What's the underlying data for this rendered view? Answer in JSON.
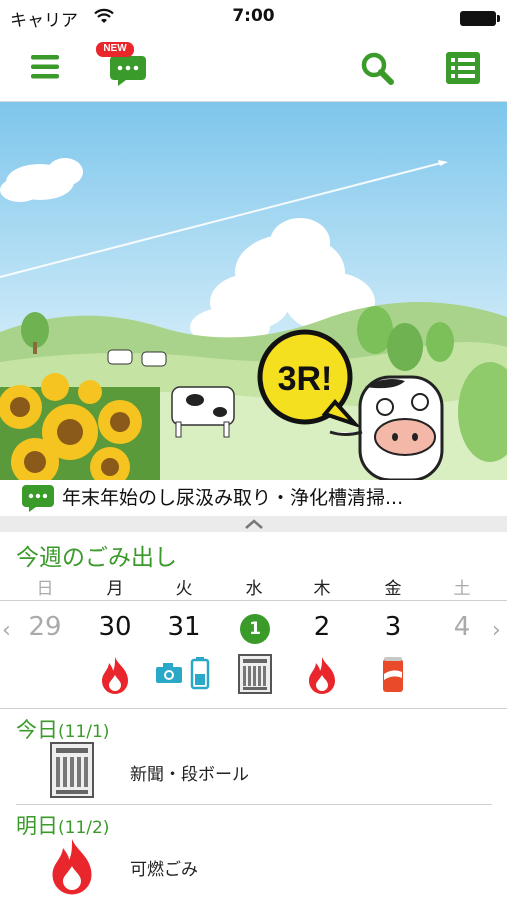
{
  "status_bar": {
    "carrier": "キャリア",
    "time": "7:00"
  },
  "toolbar": {
    "new_badge": "NEW"
  },
  "banner": {
    "bubble_text": "3R!"
  },
  "news": {
    "text": "年末年始のし尿汲み取り・浄化槽清掃..."
  },
  "week": {
    "title": "今週のごみ出し",
    "days": [
      {
        "dow": "日",
        "num": "29",
        "faded": true,
        "icons": []
      },
      {
        "dow": "月",
        "num": "30",
        "faded": false,
        "icons": [
          "flame-icon"
        ]
      },
      {
        "dow": "火",
        "num": "31",
        "faded": false,
        "icons": [
          "camera-icon",
          "battery-icon"
        ]
      },
      {
        "dow": "水",
        "num": "1",
        "faded": false,
        "today": true,
        "icons": [
          "newspaper-icon"
        ]
      },
      {
        "dow": "木",
        "num": "2",
        "faded": false,
        "icons": [
          "flame-icon"
        ]
      },
      {
        "dow": "金",
        "num": "3",
        "faded": false,
        "icons": [
          "can-icon"
        ]
      },
      {
        "dow": "土",
        "num": "4",
        "faded": true,
        "icons": []
      }
    ],
    "prev_arrow": "‹",
    "next_arrow": "›"
  },
  "schedule": [
    {
      "label": "今日",
      "date": "(11/1)",
      "item": "新聞・段ボール",
      "icon": "newspaper-icon"
    },
    {
      "label": "明日",
      "date": "(11/2)",
      "item": "可燃ごみ",
      "icon": "flame-icon"
    }
  ],
  "colors": {
    "accent": "#3a9a2a",
    "flame": "#e8262c",
    "can": "#e84a2a",
    "camera": "#2aa8c8",
    "badge": "#e8262c"
  }
}
